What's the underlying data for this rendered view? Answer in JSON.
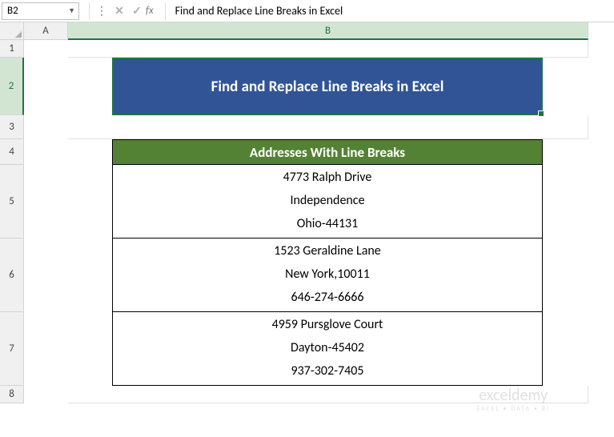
{
  "formula_bar": {
    "name_box": "B2",
    "formula": "Find and Replace Line Breaks in Excel"
  },
  "columns": [
    "A",
    "B"
  ],
  "row_numbers": [
    "1",
    "2",
    "3",
    "4",
    "5",
    "6",
    "7",
    "8"
  ],
  "cells": {
    "b2": "Find and Replace Line Breaks in Excel",
    "b4": "Addresses With Line Breaks",
    "b5": {
      "line1": "4773 Ralph Drive",
      "line2": "Independence",
      "line3": "Ohio-44131"
    },
    "b6": {
      "line1": "1523 Geraldine Lane",
      "line2": "New York,10011",
      "line3": "646-274-6666"
    },
    "b7": {
      "line1": "4959 Pursglove Court",
      "line2": "Dayton-45402",
      "line3": "937-302-7405"
    }
  },
  "watermark": {
    "main": "exceldemy",
    "sub": "EXCEL • DATA • BI"
  }
}
